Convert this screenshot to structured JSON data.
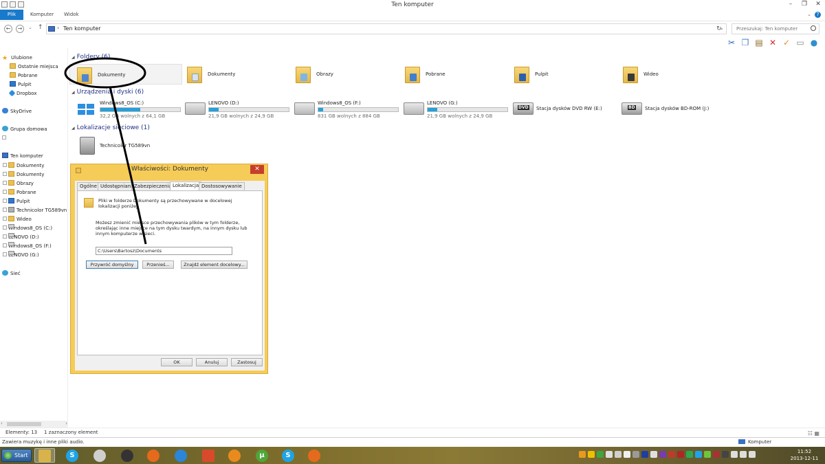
{
  "window": {
    "title": "Ten komputer"
  },
  "ribbon": {
    "tabs": [
      "Plik",
      "Komputer",
      "Widok"
    ]
  },
  "address": {
    "path": "Ten komputer",
    "search_placeholder": "Przeszukaj: Ten komputer"
  },
  "nav": {
    "favorites": "Ulubione",
    "fav_items": [
      "Ostatnie miejsca",
      "Pobrane",
      "Pulpit",
      "Dropbox"
    ],
    "skydrive": "SkyDrive",
    "homegroup": "Grupa domowa",
    "thispc": "Ten komputer",
    "pc_items": [
      "Dokumenty",
      "Dokumenty",
      "Obrazy",
      "Pobrane",
      "Pulpit",
      "Technicolor TG589vn",
      "Wideo",
      "Windows8_OS (C:)",
      "LENOVO (D:)",
      "Windows8_OS (F:)",
      "LENOVO (G:)"
    ],
    "network": "Sieć"
  },
  "content": {
    "folders_header": "Foldery (6)",
    "folders": [
      "Dokumenty",
      "Dokumenty",
      "Obrazy",
      "Pobrane",
      "Pulpit",
      "Wideo"
    ],
    "devices_header": "Urządzenia i dyski (6)",
    "drives": [
      {
        "name": "Windows8_OS (C:)",
        "free": "32,2 GB wolnych z 64,1 GB",
        "used_fraction": 0.5
      },
      {
        "name": "LENOVO (D:)",
        "free": "21,9 GB wolnych z 24,9 GB",
        "used_fraction": 0.12
      },
      {
        "name": "Windows8_OS (F:)",
        "free": "831 GB wolnych z 884 GB",
        "used_fraction": 0.06
      },
      {
        "name": "LENOVO (G:)",
        "free": "21,9 GB wolnych z 24,9 GB",
        "used_fraction": 0.12
      }
    ],
    "optical": [
      "Stacja dysków DVD RW (E:)",
      "Stacja dysków BD-ROM (J:)"
    ],
    "optical_badges": [
      "DVD",
      "BD"
    ],
    "network_header": "Lokalizacje sieciowe (1)",
    "network_items": [
      "Technicolor TG589vn"
    ]
  },
  "dialog": {
    "title": "Właściwości: Dokumenty",
    "close": "✕",
    "tabs": [
      "Ogólne",
      "Udostępnianie",
      "Zabezpieczenia",
      "Lokalizacja",
      "Dostosowywanie"
    ],
    "active_tab": "Lokalizacja",
    "intro_line1": "Pliki w folderze Dokumenty są przechowywane w docelowej",
    "intro_line2": "lokalizacji poniżej.",
    "desc_line1": "Możesz zmienić miejsce przechowywania plików w tym folderze,",
    "desc_line2": "określając inne miejsce na tym dysku twardym, na innym dysku lub",
    "desc_line3": "innym komputerze w sieci.",
    "path": "C:\\Users\\Bartosz\\Documents",
    "btn_restore": "Przywróć domyślny",
    "btn_move": "Przenieś...",
    "btn_find": "Znajdź element docelowy...",
    "btn_ok": "OK",
    "btn_cancel": "Anuluj",
    "btn_apply": "Zastosuj"
  },
  "status": {
    "elements": "Elementy: 13",
    "selected": "1 zaznaczony element",
    "info": "Zawiera muzykę i inne pliki audio.",
    "location": "Komputer"
  },
  "taskbar": {
    "start": "Start",
    "time": "11:52",
    "date": "2013-12-11"
  },
  "colors": {
    "accent": "#1979ca",
    "dialog_frame": "#f6cc58",
    "drive_bar": "#26a0da",
    "close_red": "#c73d2b"
  }
}
